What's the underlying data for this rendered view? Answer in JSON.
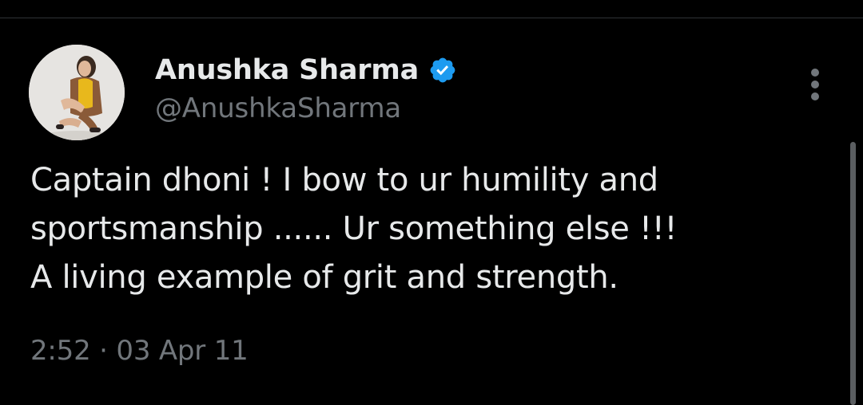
{
  "author": {
    "display_name": "Anushka Sharma",
    "handle": "@AnushkaSharma",
    "verified_icon": "verified-badge-icon",
    "verified_color": "#1d9bf0"
  },
  "tweet": {
    "text": "Captain dhoni ! I bow to ur humility and\nsportsmanship ...... Ur something else !!!\nA living example of grit and strength.",
    "time": "2:52",
    "separator": "·",
    "date": "03 Apr 11"
  },
  "menu": {
    "icon": "more-options-icon"
  },
  "colors": {
    "background": "#000000",
    "text": "#e7e9ea",
    "secondary": "#71767b"
  }
}
